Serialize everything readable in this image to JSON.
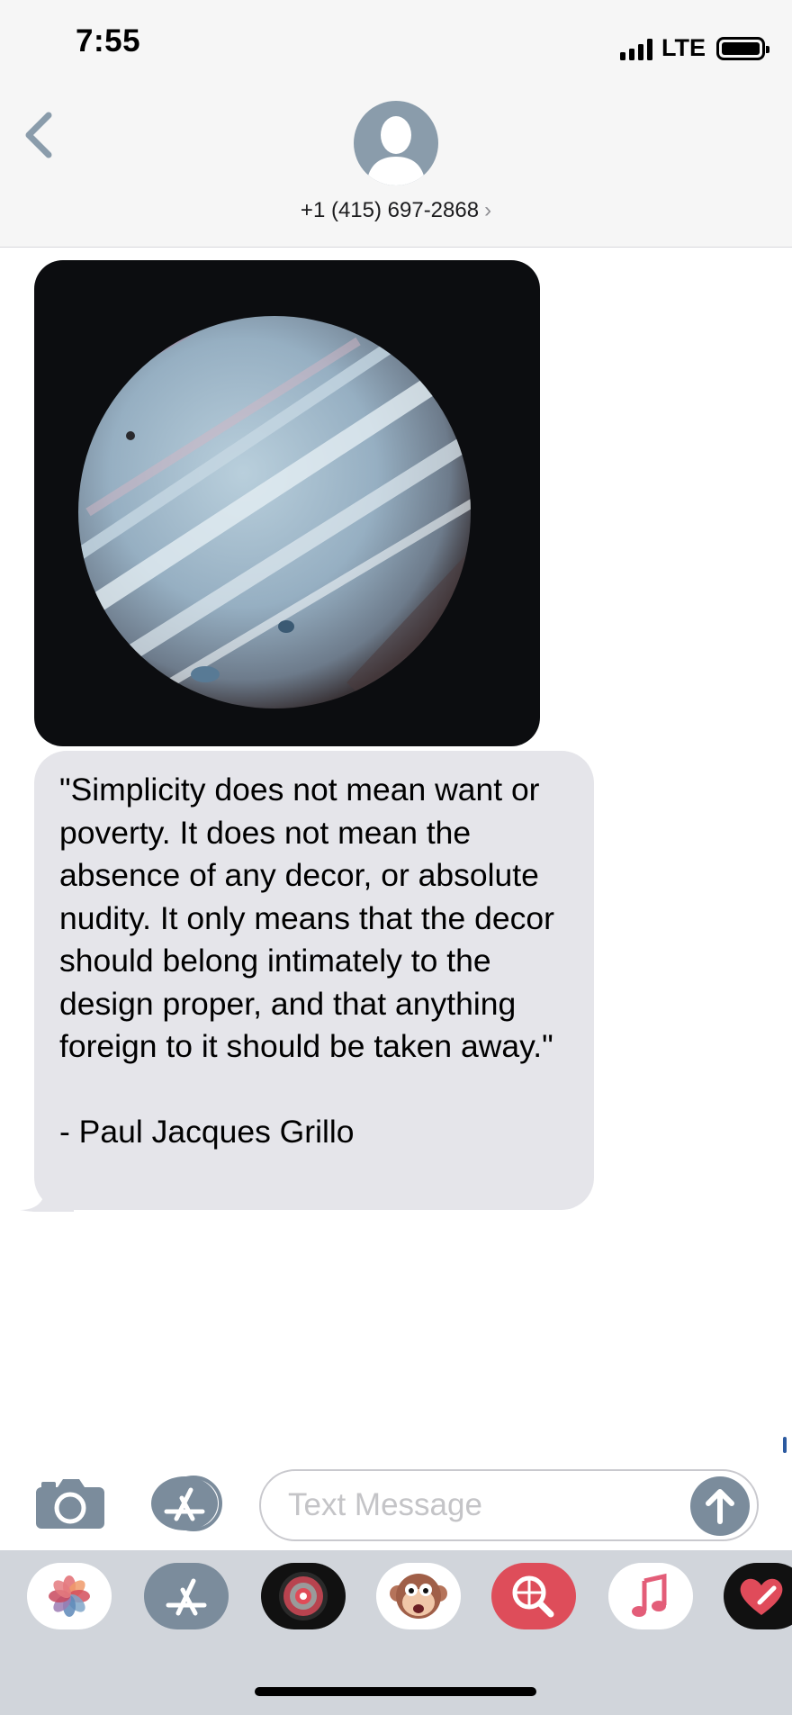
{
  "status_bar": {
    "time": "7:55",
    "network": "LTE"
  },
  "header": {
    "contact": "+1 (415) 697-2868",
    "chevron": "›"
  },
  "messages": [
    {
      "type": "image",
      "description_icon": "planet-photo"
    },
    {
      "type": "text",
      "text": "\"Simplicity does not mean want or poverty. It does not mean the absence of any decor, or absolute nudity. It only means that the decor should belong intimately to the design proper, and that anything foreign to it should be taken away.\"\n\n - Paul Jacques Grillo"
    }
  ],
  "compose": {
    "placeholder": "Text Message"
  },
  "app_drawer": {
    "apps": [
      "photos-app",
      "app-store-app",
      "camera-app",
      "animoji-app",
      "search-app",
      "music-app",
      "heart-app"
    ]
  },
  "colors": {
    "header_bg": "#f6f6f6",
    "received_bubble": "#e5e5ea",
    "accent_gray": "#7b8c9c",
    "drawer_bg": "#d1d5db"
  }
}
